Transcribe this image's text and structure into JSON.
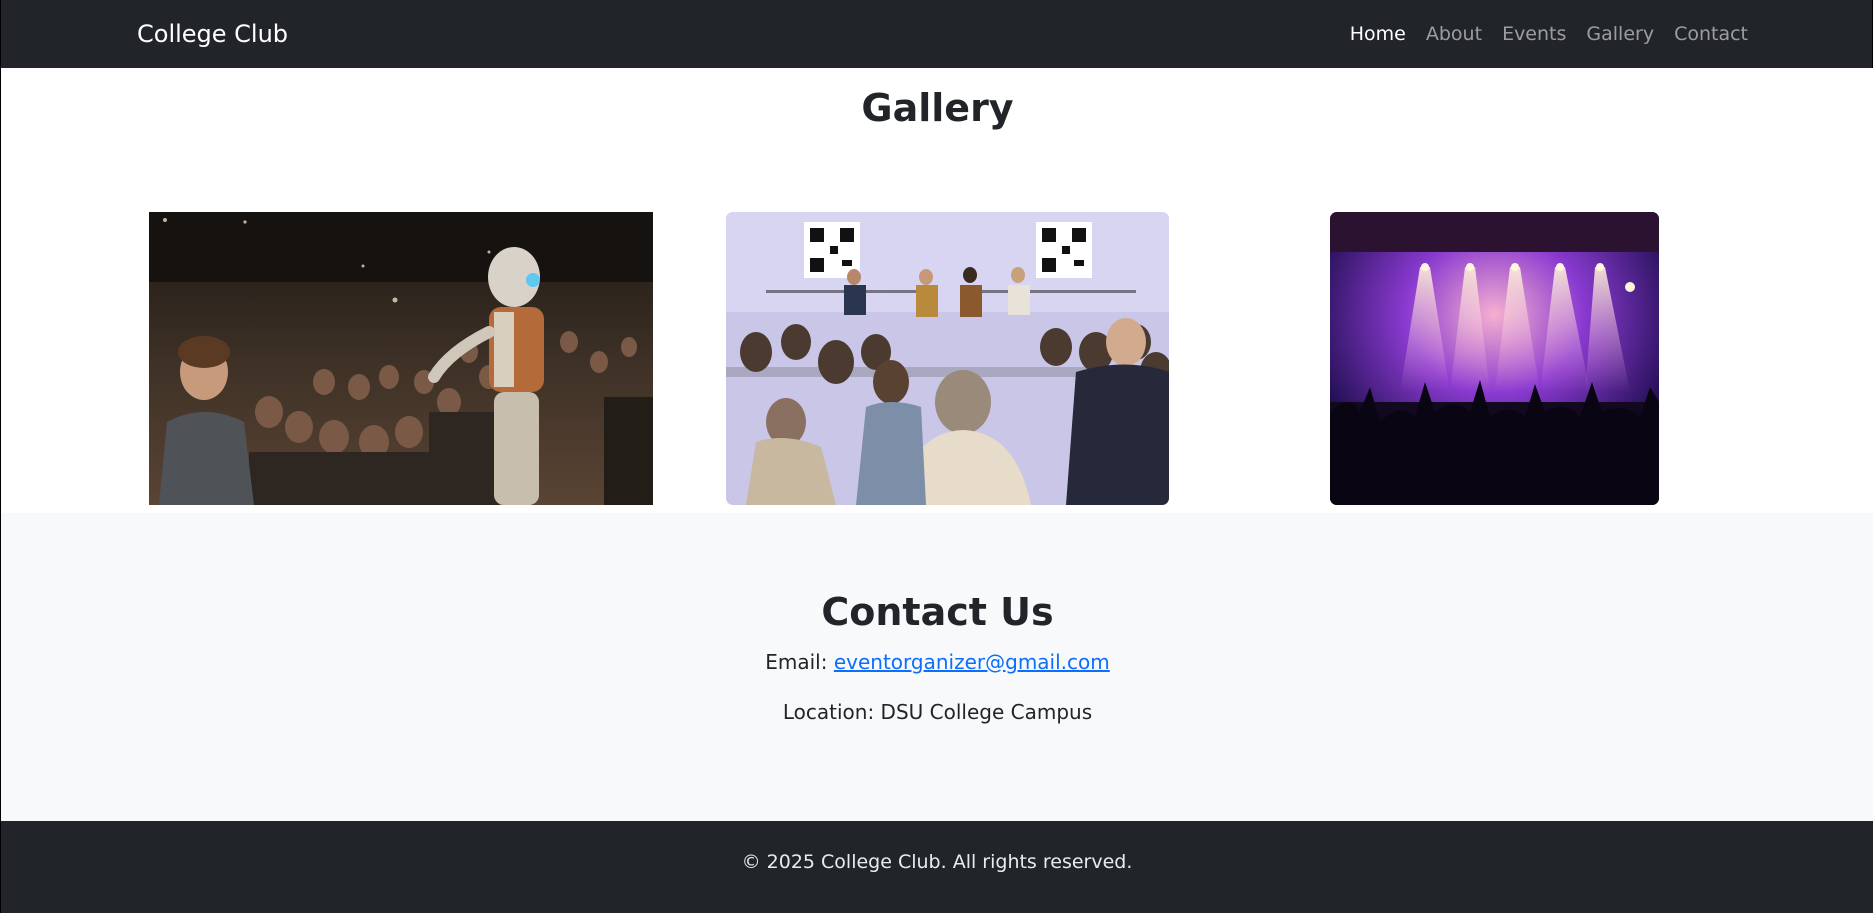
{
  "navbar": {
    "brand": "College Club",
    "links": [
      {
        "label": "Home",
        "active": true
      },
      {
        "label": "About",
        "active": false
      },
      {
        "label": "Events",
        "active": false
      },
      {
        "label": "Gallery",
        "active": false
      },
      {
        "label": "Contact",
        "active": false
      }
    ]
  },
  "gallery": {
    "title": "Gallery",
    "images": [
      {
        "name": "robot-audience-photo"
      },
      {
        "name": "panel-discussion-photo"
      },
      {
        "name": "concert-stage-photo"
      }
    ]
  },
  "contact": {
    "title": "Contact Us",
    "email_label": "Email:",
    "email": "eventorganizer@gmail.com",
    "location": "Location: DSU College Campus"
  },
  "footer": {
    "text": "© 2025 College Club. All rights reserved."
  },
  "colors": {
    "navbar_bg": "#212529",
    "contact_bg": "#f8f9fa",
    "link": "#0d6efd"
  }
}
